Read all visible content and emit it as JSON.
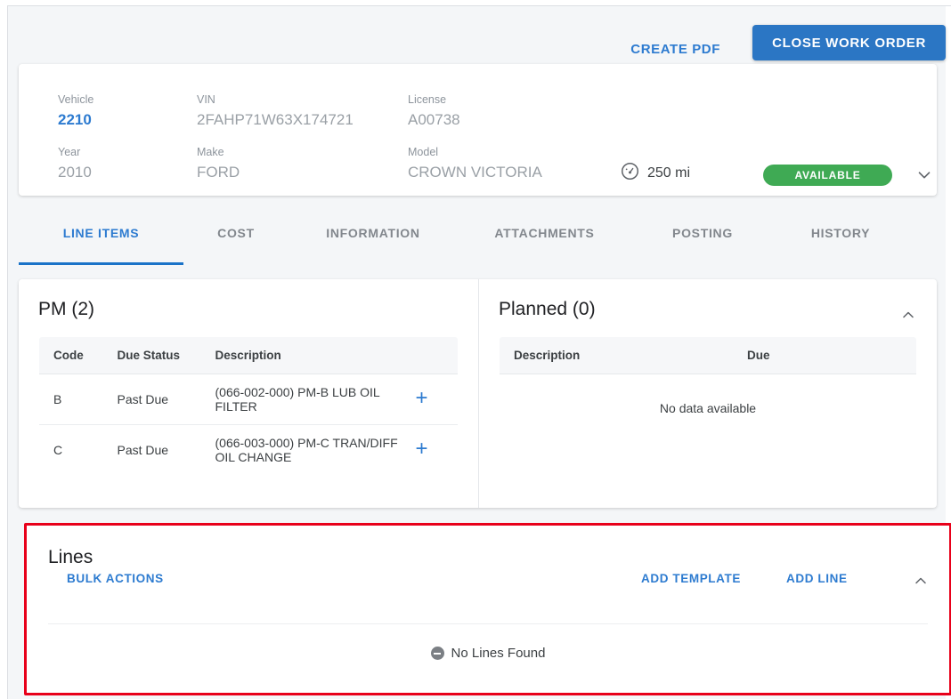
{
  "colors": {
    "primary_blue": "#2b76c4",
    "link_blue": "#2d7bd0",
    "status_green": "#3faa54",
    "highlight_red": "#e8001a",
    "page_bg": "#f4f6f8"
  },
  "actionbar": {
    "create_pdf_label": "CREATE PDF",
    "close_work_order_label": "CLOSE WORK ORDER"
  },
  "vehicle_card": {
    "fields": [
      {
        "label": "Vehicle",
        "value": "2210",
        "is_link": true
      },
      {
        "label": "VIN",
        "value": "2FAHP71W63X174721",
        "is_link": false
      },
      {
        "label": "License",
        "value": "A00738",
        "is_link": false
      },
      {
        "label": "Year",
        "value": "2010",
        "is_link": false
      },
      {
        "label": "Make",
        "value": "FORD",
        "is_link": false
      },
      {
        "label": "Model",
        "value": "CROWN VICTORIA",
        "is_link": false
      }
    ],
    "odometer": {
      "icon": "gauge-icon",
      "value": "250 mi"
    },
    "status": "AVAILABLE",
    "expand_icon": "chevron-down-icon"
  },
  "tabs": [
    {
      "label": "LINE ITEMS",
      "active": true
    },
    {
      "label": "COST",
      "active": false
    },
    {
      "label": "INFORMATION",
      "active": false
    },
    {
      "label": "ATTACHMENTS",
      "active": false
    },
    {
      "label": "POSTING",
      "active": false
    },
    {
      "label": "HISTORY",
      "active": false
    }
  ],
  "pm": {
    "title": "PM (2)",
    "columns": [
      "Code",
      "Due Status",
      "Description"
    ],
    "rows": [
      {
        "code": "B",
        "due_status": "Past Due",
        "description": "(066-002-000) PM-B LUB OIL FILTER",
        "action_icon": "plus-icon"
      },
      {
        "code": "C",
        "due_status": "Past Due",
        "description": "(066-003-000) PM-C TRAN/DIFF OIL CHANGE",
        "action_icon": "plus-icon"
      }
    ]
  },
  "planned": {
    "title": "Planned (0)",
    "columns": [
      "Description",
      "Due"
    ],
    "empty_text": "No data available",
    "collapse_icon": "chevron-up-icon"
  },
  "lines": {
    "title": "Lines",
    "bulk_actions_label": "BULK ACTIONS",
    "add_template_label": "ADD TEMPLATE",
    "add_line_label": "ADD LINE",
    "empty_text": "No Lines Found",
    "empty_icon": "minus-circle-icon",
    "collapse_icon": "chevron-up-icon"
  }
}
